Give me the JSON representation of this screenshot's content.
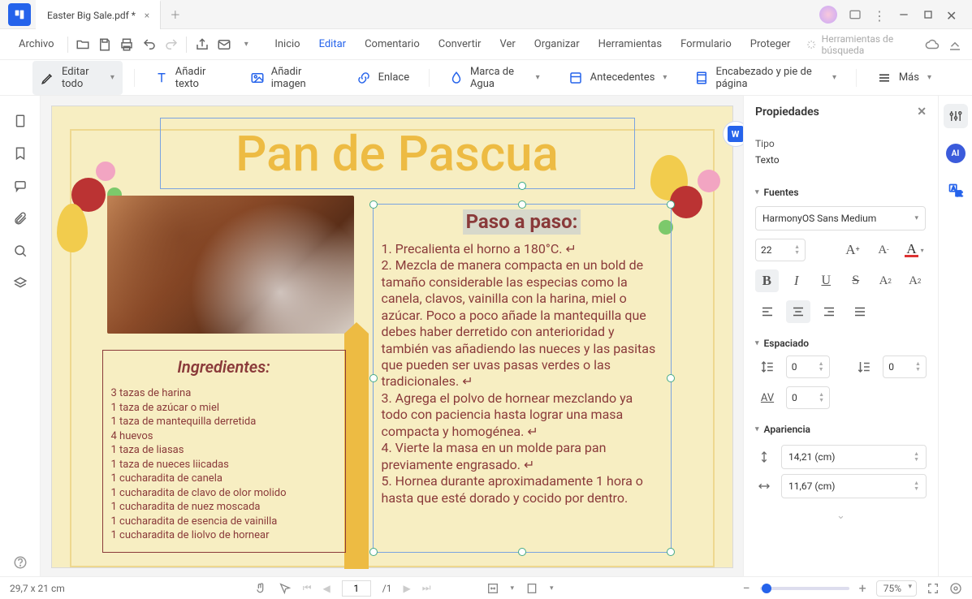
{
  "tab": {
    "title": "Easter Big Sale.pdf *"
  },
  "menu": {
    "file": "Archivo",
    "items": [
      "Inicio",
      "Editar",
      "Comentario",
      "Convertir",
      "Ver",
      "Organizar",
      "Herramientas",
      "Formulario",
      "Proteger"
    ],
    "active": 1,
    "search": "Herramientas de búsqueda"
  },
  "toolbar": {
    "edit_all": "Editar todo",
    "add_text": "Añadir texto",
    "add_image": "Añadir imagen",
    "link": "Enlace",
    "watermark": "Marca de Agua",
    "background": "Antecedentes",
    "header_footer": "Encabezado y pie de página",
    "more": "Más"
  },
  "doc": {
    "title": "Pan de Pascua",
    "word_badge": "W",
    "ingredients_title": "Ingredientes:",
    "ingredients": [
      "3 tazas de harina",
      "1 taza de azúcar o miel",
      "1 taza de mantequilla derretida",
      "4 huevos",
      "1 taza de liasas",
      "1 taza de nueces liicadas",
      "1 cucharadita de canela",
      "1 cucharadita de clavo de olor molido",
      "1 cucharadita de nuez moscada",
      "1 cucharadita de esencia de vainilla",
      "1 cucharadita de liolvo de hornear"
    ],
    "steps_title": "Paso a paso:",
    "steps_body": "1. Precalienta el horno a 180°C. ↵\n2. Mezcla de manera compacta en un bold de tamaño considerable las especias como la canela, clavos, vainilla con la harina, miel o azúcar. Poco a poco añade la mantequilla que debes haber derretido con anterioridad y también vas añadiendo las nueces y las pasitas que pueden ser uvas pasas verdes o las tradicionales. ↵\n3. Agrega el polvo de hornear mezclando ya todo con paciencia hasta lograr una masa compacta y homogénea. ↵\n4. Vierte la masa en un molde para pan previamente engrasado. ↵\n5. Hornea durante aproximadamente 1 hora o hasta que esté dorado y cocido por dentro."
  },
  "props": {
    "panel": "Propiedades",
    "type_label": "Tipo",
    "type_value": "Texto",
    "fonts": "Fuentes",
    "font_name": "HarmonyOS Sans Medium",
    "font_size": "22",
    "spacing": "Espaciado",
    "line": "0",
    "para": "0",
    "char": "0",
    "appearance": "Apariencia",
    "width": "14,21 (cm)",
    "height": "11,67 (cm)"
  },
  "status": {
    "dims": "29,7 x 21 cm",
    "page_current": "1",
    "page_total": "/1",
    "zoom": "75%"
  }
}
